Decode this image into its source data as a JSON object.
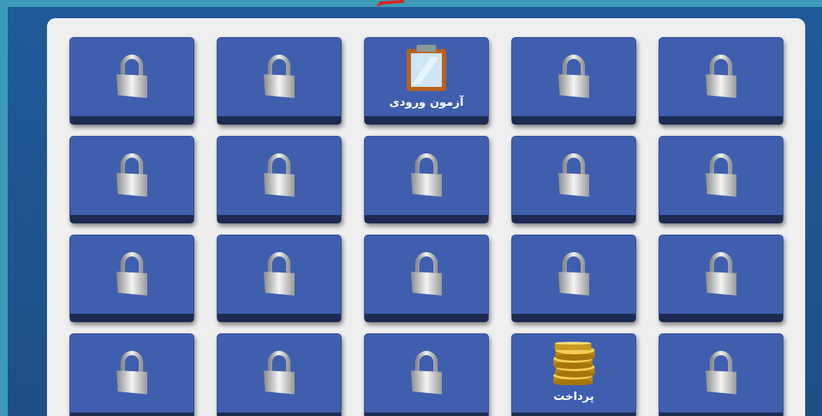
{
  "tiles": [
    {
      "kind": "locked"
    },
    {
      "kind": "locked"
    },
    {
      "kind": "exam",
      "label": "آزمون ورودی"
    },
    {
      "kind": "locked"
    },
    {
      "kind": "locked"
    },
    {
      "kind": "locked"
    },
    {
      "kind": "locked"
    },
    {
      "kind": "locked"
    },
    {
      "kind": "locked"
    },
    {
      "kind": "locked"
    },
    {
      "kind": "locked"
    },
    {
      "kind": "locked"
    },
    {
      "kind": "locked"
    },
    {
      "kind": "locked"
    },
    {
      "kind": "locked"
    },
    {
      "kind": "locked"
    },
    {
      "kind": "locked"
    },
    {
      "kind": "locked"
    },
    {
      "kind": "payment",
      "label": "پرداخت"
    },
    {
      "kind": "locked"
    }
  ]
}
